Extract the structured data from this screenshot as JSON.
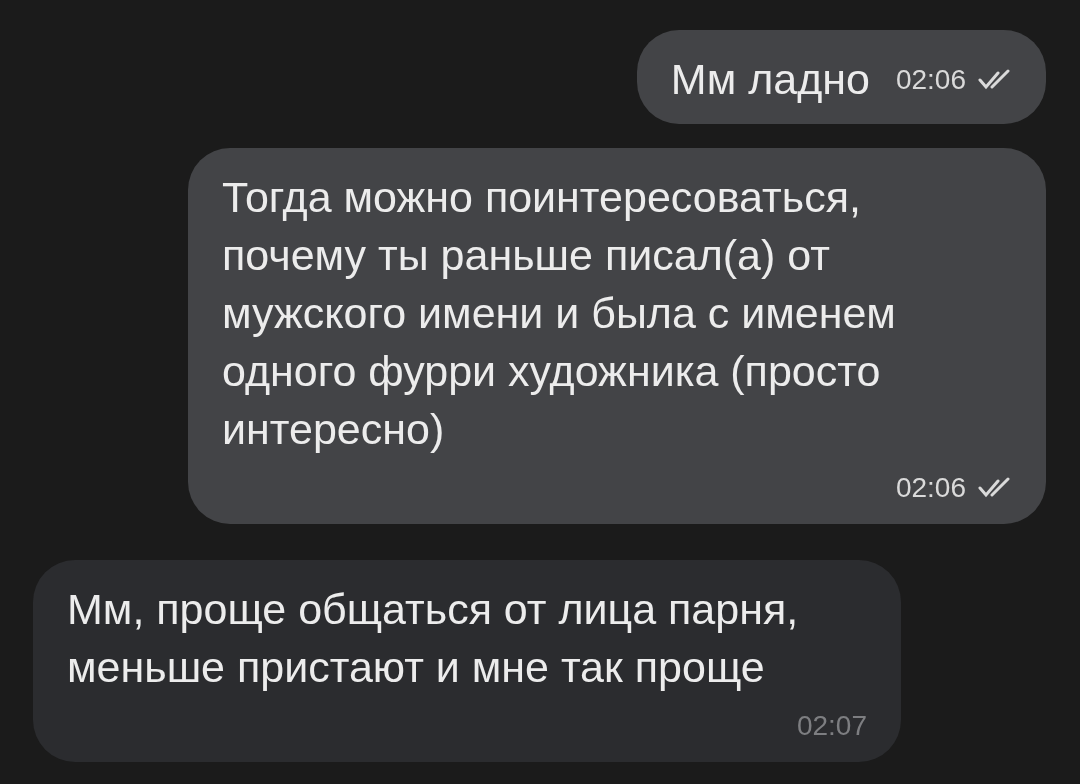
{
  "messages": [
    {
      "kind": "out",
      "text": "Мм ладно",
      "time": "02:06",
      "read": true
    },
    {
      "kind": "out",
      "text": "Тогда можно поинтересоваться, почему ты раньше писал(а) от мужского имени и была с именем одного фурри художника (просто интересно)",
      "time": "02:06",
      "read": true
    },
    {
      "kind": "in",
      "text": "Мм, проще общаться от лица парня, меньше пристают и мне так проще",
      "time": "02:07"
    }
  ]
}
